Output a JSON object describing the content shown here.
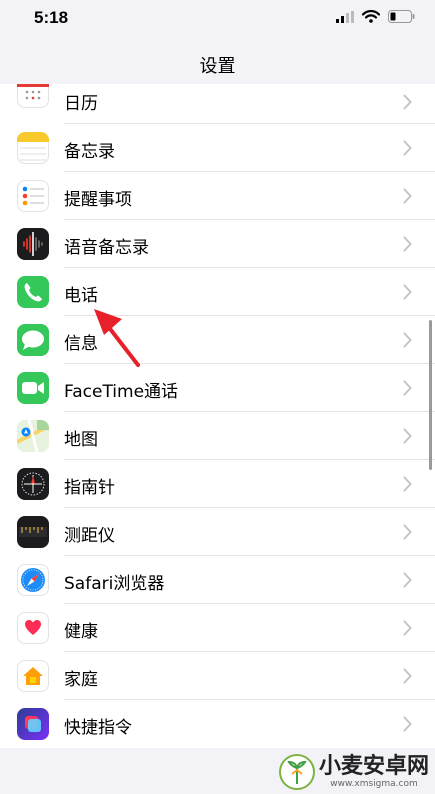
{
  "status_bar": {
    "time": "5:18",
    "battery_level": 0.2
  },
  "nav": {
    "title": "设置"
  },
  "items": [
    {
      "label": "日历",
      "icon": "calendar-icon"
    },
    {
      "label": "备忘录",
      "icon": "notes-icon"
    },
    {
      "label": "提醒事项",
      "icon": "reminders-icon"
    },
    {
      "label": "语音备忘录",
      "icon": "voice-memos-icon"
    },
    {
      "label": "电话",
      "icon": "phone-icon"
    },
    {
      "label": "信息",
      "icon": "messages-icon"
    },
    {
      "label": "FaceTime通话",
      "icon": "facetime-icon"
    },
    {
      "label": "地图",
      "icon": "maps-icon"
    },
    {
      "label": "指南针",
      "icon": "compass-icon"
    },
    {
      "label": "测距仪",
      "icon": "measure-icon"
    },
    {
      "label": "Safari浏览器",
      "icon": "safari-icon"
    },
    {
      "label": "健康",
      "icon": "health-icon"
    },
    {
      "label": "家庭",
      "icon": "home-icon"
    },
    {
      "label": "快捷指令",
      "icon": "shortcuts-icon"
    }
  ],
  "watermark": {
    "title": "小麦安卓网",
    "url": "www.xmsigma.com"
  },
  "colors": {
    "phone": "#34c759",
    "messages": "#34c759",
    "facetime": "#34c759",
    "voice": "#1c1c1e",
    "arrow": "#e8202a",
    "chevron": "#c4c4c7"
  }
}
